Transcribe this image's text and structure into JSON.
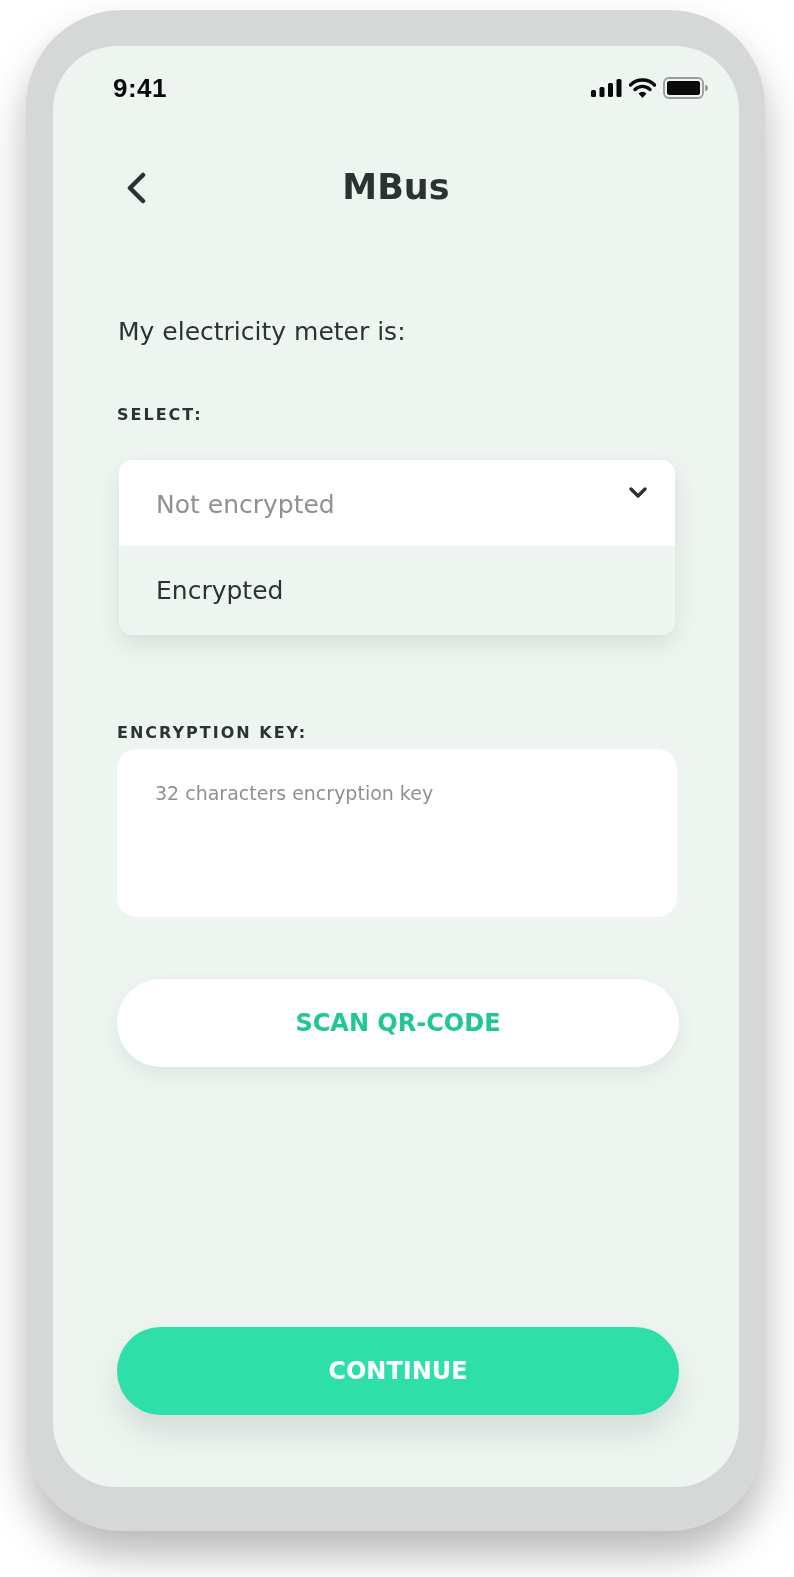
{
  "status_bar": {
    "time": "9:41"
  },
  "header": {
    "title": "MBus"
  },
  "prompt": "My electricity meter is:",
  "select": {
    "label": "SELECT:",
    "value": "Not encrypted",
    "expanded": true,
    "options": [
      {
        "label": "Encrypted",
        "selected": false
      }
    ]
  },
  "encryption_key": {
    "label": "ENCRYPTION KEY:",
    "placeholder": "32 characters encryption key"
  },
  "buttons": [
    {
      "kind": "secondary",
      "label": "SCAN QR-CODE"
    },
    {
      "kind": "primary",
      "label": "CONTINUE"
    }
  ]
}
